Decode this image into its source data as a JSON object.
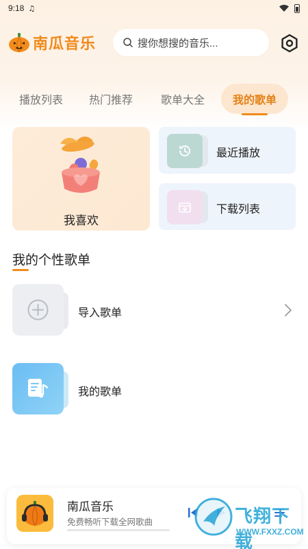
{
  "status_bar": {
    "time": "9:18",
    "music_glyph": "♫"
  },
  "app": {
    "title": "南瓜音乐",
    "brand_color": "#f08a1c"
  },
  "search": {
    "placeholder": "搜你想搜的音乐..."
  },
  "tabs": [
    {
      "label": "播放列表",
      "active": false
    },
    {
      "label": "热门推荐",
      "active": false
    },
    {
      "label": "歌单大全",
      "active": false
    },
    {
      "label": "我的歌单",
      "active": true
    }
  ],
  "quick_cards": {
    "favorite": {
      "label": "我喜欢"
    },
    "recent": {
      "label": "最近播放",
      "icon": "clock-icon"
    },
    "downloads": {
      "label": "下载列表",
      "icon": "download-box-icon"
    }
  },
  "section": {
    "title": "我的个性歌单"
  },
  "playlists": [
    {
      "label": "导入歌单",
      "icon": "plus-circle-icon"
    },
    {
      "label": "我的歌单",
      "icon": "music-note-icon"
    }
  ],
  "player": {
    "title": "南瓜音乐",
    "subtitle": "免费畅听下载全网歌曲",
    "progress": 0
  },
  "watermark": {
    "text": "飞翔下载",
    "url": "WWW.FXXZ.COM"
  }
}
